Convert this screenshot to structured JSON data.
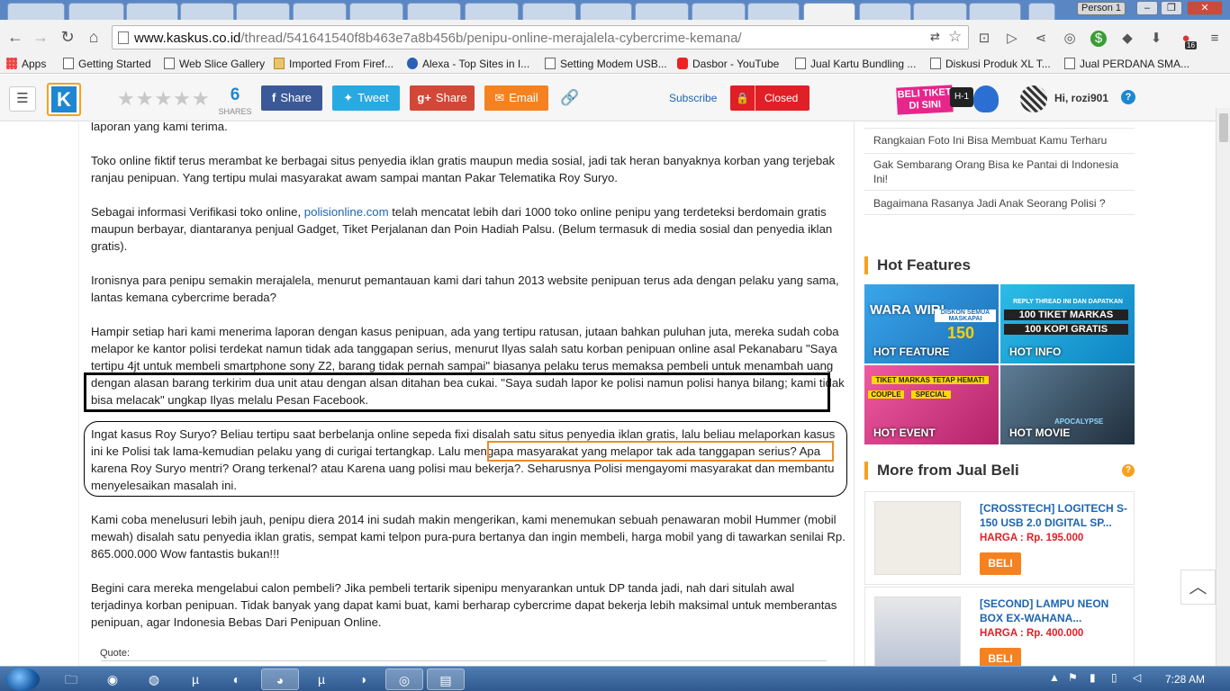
{
  "browser": {
    "person_button": "Person 1",
    "url_host": "www.kaskus.co.id",
    "url_path": "/thread/541641540f8b463e7a8b456b/penipu-online-merajalela-cybercrime-kemana/",
    "bookmarks": [
      "Apps",
      "Getting Started",
      "Web Slice Gallery",
      "Imported From Firef...",
      "Alexa - Top Sites in I...",
      "Setting Modem USB...",
      "Dasbor - YouTube",
      "Jual Kartu Bundling ...",
      "Diskusi Produk XL T...",
      "Jual PERDANA SMA..."
    ],
    "ext_badge": "16"
  },
  "header": {
    "shares_count": "6",
    "shares_label": "SHARES",
    "share_fb": "Share",
    "share_tw": "Tweet",
    "share_gp": "Share",
    "share_email": "Email",
    "subscribe": "Subscribe",
    "closed": "Closed",
    "banner_text": "BELI TIKET DI SINI",
    "banner_h1": "H-1",
    "user_greeting": "Hi, rozi901",
    "rating_stars": 0
  },
  "post": {
    "p0": "laporan yang kami terima.",
    "p1": "Toko online fiktif terus merambat ke berbagai situs penyedia iklan gratis maupun media sosial, jadi tak heran banyaknya korban yang terjebak ranjau penipuan. Yang tertipu mulai masyarakat awam sampai mantan Pakar Telematika Roy Suryo.",
    "p2_before": "Sebagai informasi Verifikasi toko online, ",
    "p2_link": "polisionline.com",
    "p2_after": " telah mencatat lebih dari 1000 toko online penipu yang terdeteksi berdomain gratis maupun berbayar, diantaranya penjual Gadget, Tiket Perjalanan dan Poin Hadiah Palsu. (Belum termasuk di media sosial dan penyedia iklan gratis).",
    "p3": "Ironisnya para penipu semakin merajalela, menurut pemantauan kami dari tahun 2013 website penipuan terus ada dengan pelaku yang sama, lantas kemana cybercrime berada?",
    "p4": "Hampir setiap hari kami menerima laporan dengan kasus penipuan, ada yang tertipu ratusan, jutaan bahkan puluhan juta, mereka sudah coba melapor ke kantor polisi terdekat namun tidak ada tanggapan serius, menurut Ilyas salah satu korban penipuan online asal Pekanabaru \"Saya tertipu 4jt untuk membeli smartphone sony Z2, barang tidak pernah sampai\" biasanya pelaku terus memaksa pembeli untuk menambah uang dengan alasan barang terkirim dua unit atau dengan alsan ditahan bea cukai. \"Saya sudah lapor ke polisi namun polisi hanya bilang; kami tidak bisa melacak\" ungkap Ilyas melalu Pesan Facebook.",
    "p5": "Ingat kasus Roy Suryo? Beliau tertipu saat berbelanja online sepeda fixi disalah satu situs penyedia iklan gratis, lalu beliau melaporkan kasus ini ke Polisi tak lama-kemudian pelaku yang di curigai tertangkap. Lalu mengapa masyarakat yang melapor tak ada tanggapan serius? Apa karena Roy Suryo mentri? Orang terkenal? atau Karena uang polisi mau bekerja?. Seharusnya Polisi mengayomi masyarakat dan membantu menyelesaikan masalah ini.",
    "p6": "Kami coba menelusuri lebih jauh, penipu diera 2014 ini sudah makin mengerikan, kami menemukan sebuah penawaran mobil Hummer (mobil mewah) disalah satu penyedia iklan gratis, sempat kami telpon pura-pura bertanya dan ingin membeli, harga mobil yang di tawarkan senilai Rp. 865.000.000 Wow fantastis bukan!!!",
    "p7": "Begini cara mereka mengelabui calon pembeli? Jika pembeli tertarik sipenipu menyarankan untuk DP tanda jadi, nah dari situlah awal terjadinya korban penipuan. Tidak banyak yang dapat kami buat, kami berharap cybercrime dapat bekerja lebih maksimal untuk memberantas penipuan, agar Indonesia Bebas Dari Penipuan Online.",
    "quote_label": "Quote:"
  },
  "sidebar": {
    "links": [
      "Rangkaian Foto Ini Bisa Membuat Kamu Terharu",
      "Gak Sembarang Orang Bisa ke Pantai di Indonesia Ini!",
      "Bagaimana Rasanya Jadi Anak Seorang Polisi ?"
    ],
    "hot_title": "Hot Features",
    "hot": [
      {
        "label": "HOT FEATURE",
        "art": "WARA WIRI",
        "art2": "DISKON SEMUA MASKAPAI",
        "art3": "150",
        "color": "#2a8fd8"
      },
      {
        "label": "HOT INFO",
        "art": "100 TIKET MARKAS",
        "art2": "100 KOPI GRATIS",
        "art3": "REPLY THREAD INI DAN DAPATKAN",
        "color": "#1aa7e0"
      },
      {
        "label": "HOT EVENT",
        "art": "TIKET MARKAS TETAP HEMAT!",
        "art2": "COUPLE",
        "art3": "SPECIAL",
        "color": "#e5337c"
      },
      {
        "label": "HOT MOVIE",
        "art": "APOCALYPSE",
        "art2": "",
        "art3": "",
        "color": "#33495e"
      }
    ],
    "jb_title": "More from Jual Beli",
    "jb_items": [
      {
        "title": "[CROSSTECH] LOGITECH S-150 USB 2.0 DIGITAL SP...",
        "price": "HARGA : Rp. 195.000",
        "btn": "BELI"
      },
      {
        "title": "[SECOND] LAMPU NEON BOX EX-WAHANA...",
        "price": "HARGA : Rp. 400.000",
        "btn": "BELI"
      }
    ]
  },
  "taskbar": {
    "clock": "7:28 AM"
  }
}
